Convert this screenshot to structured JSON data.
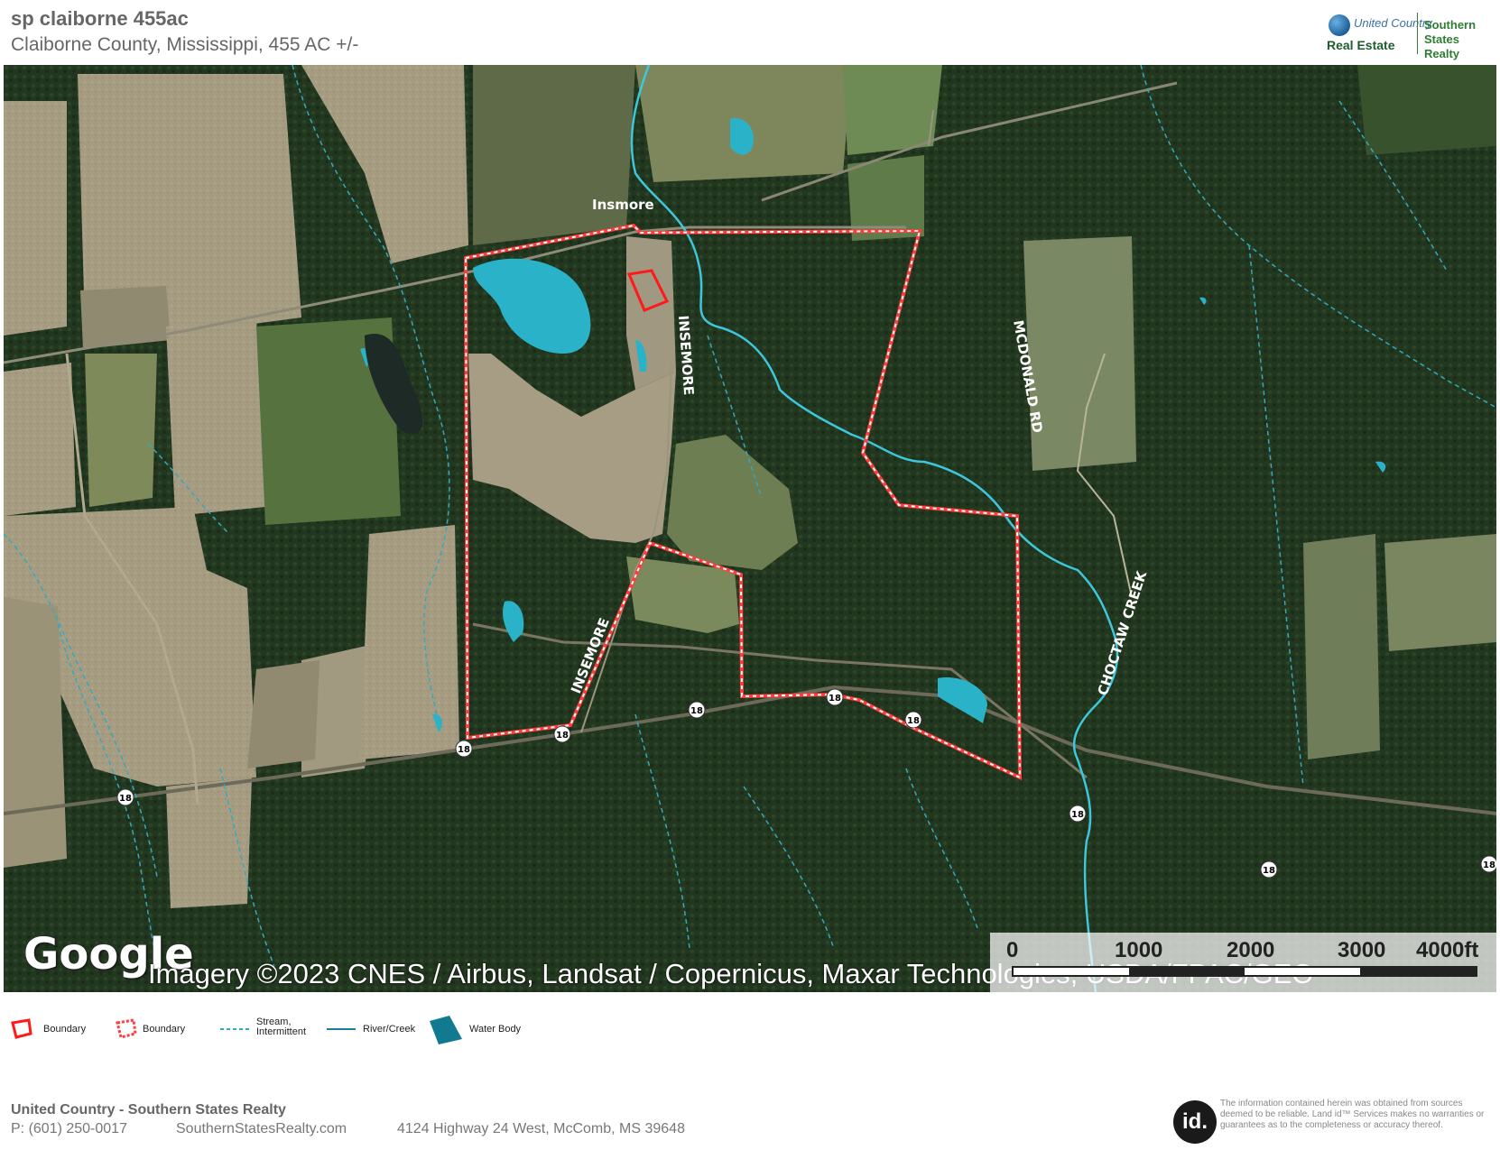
{
  "header": {
    "title": "sp claiborne 455ac",
    "subtitle": "Claiborne County, Mississippi, 455 AC +/-"
  },
  "logo": {
    "line1": "United",
    "line1b": "Country",
    "line2": "Real Estate",
    "southern": "Southern",
    "states": "States Realty"
  },
  "map": {
    "place_label": "Insmore",
    "road_labels": [
      "INSEMORE",
      "INSEMORE",
      "MCDONALD RD",
      "CHOCTAW CREEK"
    ],
    "route_shield": "18",
    "watermark": "Google",
    "attribution": "Imagery ©2023 CNES / Airbus, Landsat / Copernicus, Maxar Technologies, USDA/FPAC/GEO",
    "scale_labels": [
      "0",
      "1000",
      "2000",
      "3000",
      "4000ft"
    ],
    "colors": {
      "boundary": "#ff3b3b",
      "water": "#2ab3c8",
      "river": "#3ec6dc",
      "stream": "#35a8c0"
    }
  },
  "legend": {
    "items": [
      {
        "label": "Boundary",
        "icon": "boundary-solid-icon"
      },
      {
        "label": "Boundary",
        "icon": "boundary-dashed-icon"
      },
      {
        "label": "Stream,\nIntermittent",
        "icon": "stream-intermittent-icon"
      },
      {
        "label": "River/Creek",
        "icon": "river-creek-icon"
      },
      {
        "label": "Water Body",
        "icon": "water-body-icon"
      }
    ]
  },
  "footer": {
    "company": "United Country - Southern States Realty",
    "phone": "P: (601) 250-0017",
    "website": "SouthernStatesRealty.com",
    "address": "4124 Highway 24 West, McComb, MS 39648",
    "id_logo": "id.",
    "disclaimer": "The information contained herein was obtained from sources deemed to be reliable. Land id™ Services makes no warranties or guarantees as to the completeness or accuracy thereof."
  }
}
